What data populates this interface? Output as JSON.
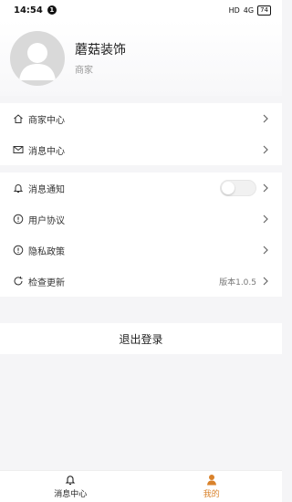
{
  "status_bar": {
    "time": "14:54",
    "notif_badge": "1",
    "network": "HD",
    "signal": "4G",
    "battery": "74"
  },
  "profile": {
    "name": "蘑菇装饰",
    "role": "商家"
  },
  "menu_group1": [
    {
      "label": "商家中心",
      "icon": "home-icon"
    },
    {
      "label": "消息中心",
      "icon": "mail-icon"
    }
  ],
  "menu_group2": [
    {
      "label": "消息通知",
      "icon": "bell-icon"
    },
    {
      "label": "用户协议",
      "icon": "info-circle-icon"
    },
    {
      "label": "隐私政策",
      "icon": "info-circle-icon"
    },
    {
      "label": "检查更新",
      "icon": "refresh-icon",
      "value": "版本1.0.5"
    }
  ],
  "logout_label": "退出登录",
  "tabs": [
    {
      "label": "消息中心",
      "icon": "bell-icon",
      "active": false
    },
    {
      "label": "我的",
      "icon": "person-icon",
      "active": true
    }
  ],
  "colors": {
    "accent": "#d9822b",
    "background": "#f5f5f7"
  }
}
